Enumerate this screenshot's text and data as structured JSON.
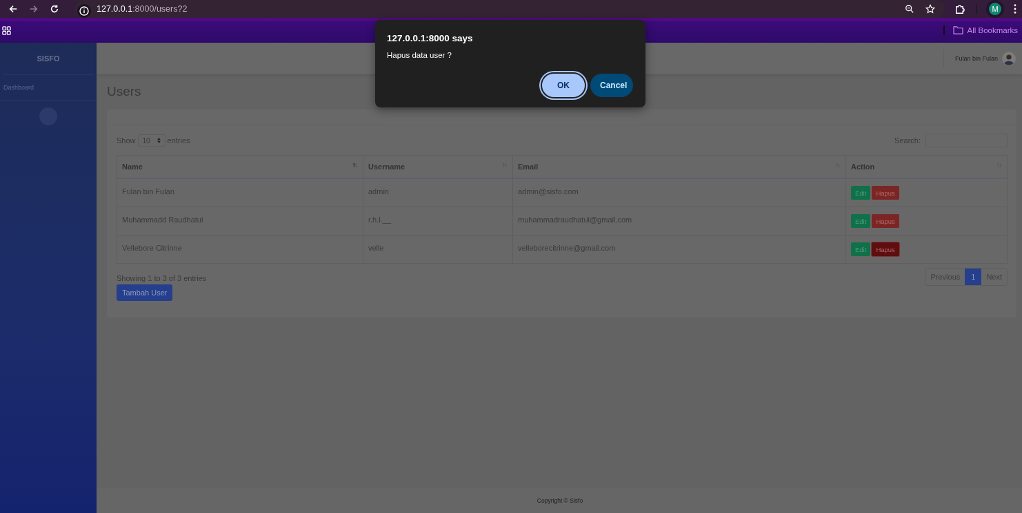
{
  "browser": {
    "url_host": "127.0.0.1",
    "url_path": ":8000/users?2",
    "avatar_letter": "M",
    "bookmarks_label": "All Bookmarks"
  },
  "sidebar": {
    "brand": "SISFO",
    "items": [
      {
        "label": "Dashboard"
      }
    ]
  },
  "topbar": {
    "user_name": "Fulan bin Fulan"
  },
  "page_title": "Users",
  "table_controls": {
    "show_label": "Show",
    "page_size": "10",
    "entries_label": "entries",
    "search_label": "Search:"
  },
  "table": {
    "columns": [
      {
        "label": "Name",
        "sorted": true
      },
      {
        "label": "Username",
        "sorted": false
      },
      {
        "label": "Email",
        "sorted": false
      },
      {
        "label": "Action",
        "sorted": false
      }
    ],
    "rows": [
      {
        "name": "Fulan bin Fulan",
        "username": "admin",
        "email": "admin@sisfo.com",
        "edit_label": "Edit",
        "delete_label": "Hapus",
        "delete_focused": false
      },
      {
        "name": "Muhammadd Raudhatul",
        "username": "r.h.l.__",
        "email": "muhammadraudhatul@gmail.com",
        "edit_label": "Edit",
        "delete_label": "Hapus",
        "delete_focused": false
      },
      {
        "name": "Vellebore Citrinne",
        "username": "velle",
        "email": "velleborecitrinne@gmail.com",
        "edit_label": "Edit",
        "delete_label": "Hapus",
        "delete_focused": true
      }
    ]
  },
  "info": "Showing 1 to 3 of 3 entries",
  "add_button": "Tambah User",
  "pagination": [
    {
      "label": "Previous",
      "selected": false
    },
    {
      "label": "1",
      "selected": true
    },
    {
      "label": "Next",
      "selected": false
    }
  ],
  "footer": "Copyright © Sisfo",
  "dialog": {
    "title": "127.0.0.1:8000 says",
    "message": "Hapus data user ?",
    "buttons": [
      {
        "label": "OK",
        "focused": true
      },
      {
        "label": "Cancel",
        "focused": false
      }
    ]
  }
}
